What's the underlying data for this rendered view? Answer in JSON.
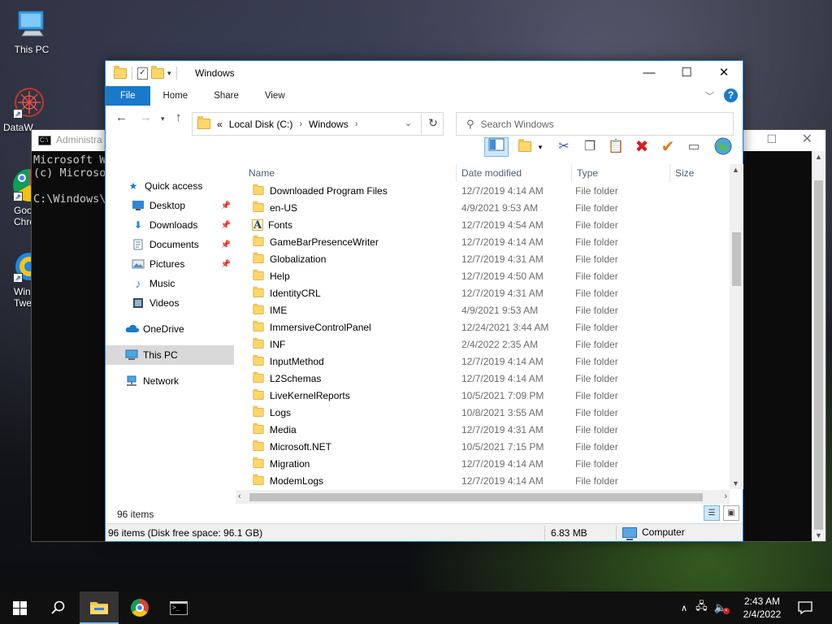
{
  "desktop": {
    "icons": [
      {
        "label": "This PC"
      },
      {
        "label": "DataW"
      },
      {
        "label": "Goo Chro"
      },
      {
        "label": "Win Twe"
      }
    ]
  },
  "cmd": {
    "title": "Administra",
    "lines": [
      "Microsoft W",
      "(c) Microsof",
      "",
      "C:\\Windows\\s"
    ]
  },
  "explorer": {
    "title": "Windows",
    "ribbon_tabs": [
      "File",
      "Home",
      "Share",
      "View"
    ],
    "address": {
      "overflow": "«",
      "crumbs": [
        "Local Disk (C:)",
        "Windows"
      ]
    },
    "search_placeholder": "Search Windows",
    "nav": {
      "quick_access": "Quick access",
      "desktop": "Desktop",
      "downloads": "Downloads",
      "documents": "Documents",
      "pictures": "Pictures",
      "music": "Music",
      "videos": "Videos",
      "onedrive": "OneDrive",
      "this_pc": "This PC",
      "network": "Network"
    },
    "columns": [
      "Name",
      "Date modified",
      "Type",
      "Size"
    ],
    "files": [
      {
        "name": "Downloaded Program Files",
        "date": "12/7/2019 4:14 AM",
        "type": "File folder",
        "icon": "folder"
      },
      {
        "name": "en-US",
        "date": "4/9/2021 9:53 AM",
        "type": "File folder",
        "icon": "folder"
      },
      {
        "name": "Fonts",
        "date": "12/7/2019 4:54 AM",
        "type": "File folder",
        "icon": "font"
      },
      {
        "name": "GameBarPresenceWriter",
        "date": "12/7/2019 4:14 AM",
        "type": "File folder",
        "icon": "folder"
      },
      {
        "name": "Globalization",
        "date": "12/7/2019 4:31 AM",
        "type": "File folder",
        "icon": "folder"
      },
      {
        "name": "Help",
        "date": "12/7/2019 4:50 AM",
        "type": "File folder",
        "icon": "folder"
      },
      {
        "name": "IdentityCRL",
        "date": "12/7/2019 4:31 AM",
        "type": "File folder",
        "icon": "folder"
      },
      {
        "name": "IME",
        "date": "4/9/2021 9:53 AM",
        "type": "File folder",
        "icon": "folder"
      },
      {
        "name": "ImmersiveControlPanel",
        "date": "12/24/2021 3:44 AM",
        "type": "File folder",
        "icon": "folder"
      },
      {
        "name": "INF",
        "date": "2/4/2022 2:35 AM",
        "type": "File folder",
        "icon": "folder"
      },
      {
        "name": "InputMethod",
        "date": "12/7/2019 4:14 AM",
        "type": "File folder",
        "icon": "folder"
      },
      {
        "name": "L2Schemas",
        "date": "12/7/2019 4:14 AM",
        "type": "File folder",
        "icon": "folder"
      },
      {
        "name": "LiveKernelReports",
        "date": "10/5/2021 7:09 PM",
        "type": "File folder",
        "icon": "folder"
      },
      {
        "name": "Logs",
        "date": "10/8/2021 3:55 AM",
        "type": "File folder",
        "icon": "folder"
      },
      {
        "name": "Media",
        "date": "12/7/2019 4:31 AM",
        "type": "File folder",
        "icon": "folder"
      },
      {
        "name": "Microsoft.NET",
        "date": "10/5/2021 7:15 PM",
        "type": "File folder",
        "icon": "folder"
      },
      {
        "name": "Migration",
        "date": "12/7/2019 4:14 AM",
        "type": "File folder",
        "icon": "folder"
      },
      {
        "name": "ModemLogs",
        "date": "12/7/2019 4:14 AM",
        "type": "File folder",
        "icon": "folder"
      }
    ],
    "item_count": "96 items",
    "status": {
      "left": "96 items (Disk free space: 96.1 GB)",
      "size": "6.83 MB",
      "location": "Computer"
    }
  },
  "taskbar": {
    "clock_time": "2:43 AM",
    "clock_date": "2/4/2022"
  },
  "colors": {
    "accent": "#1979ca",
    "delete_red": "#d81e1e",
    "check_orange": "#e07b1c"
  }
}
